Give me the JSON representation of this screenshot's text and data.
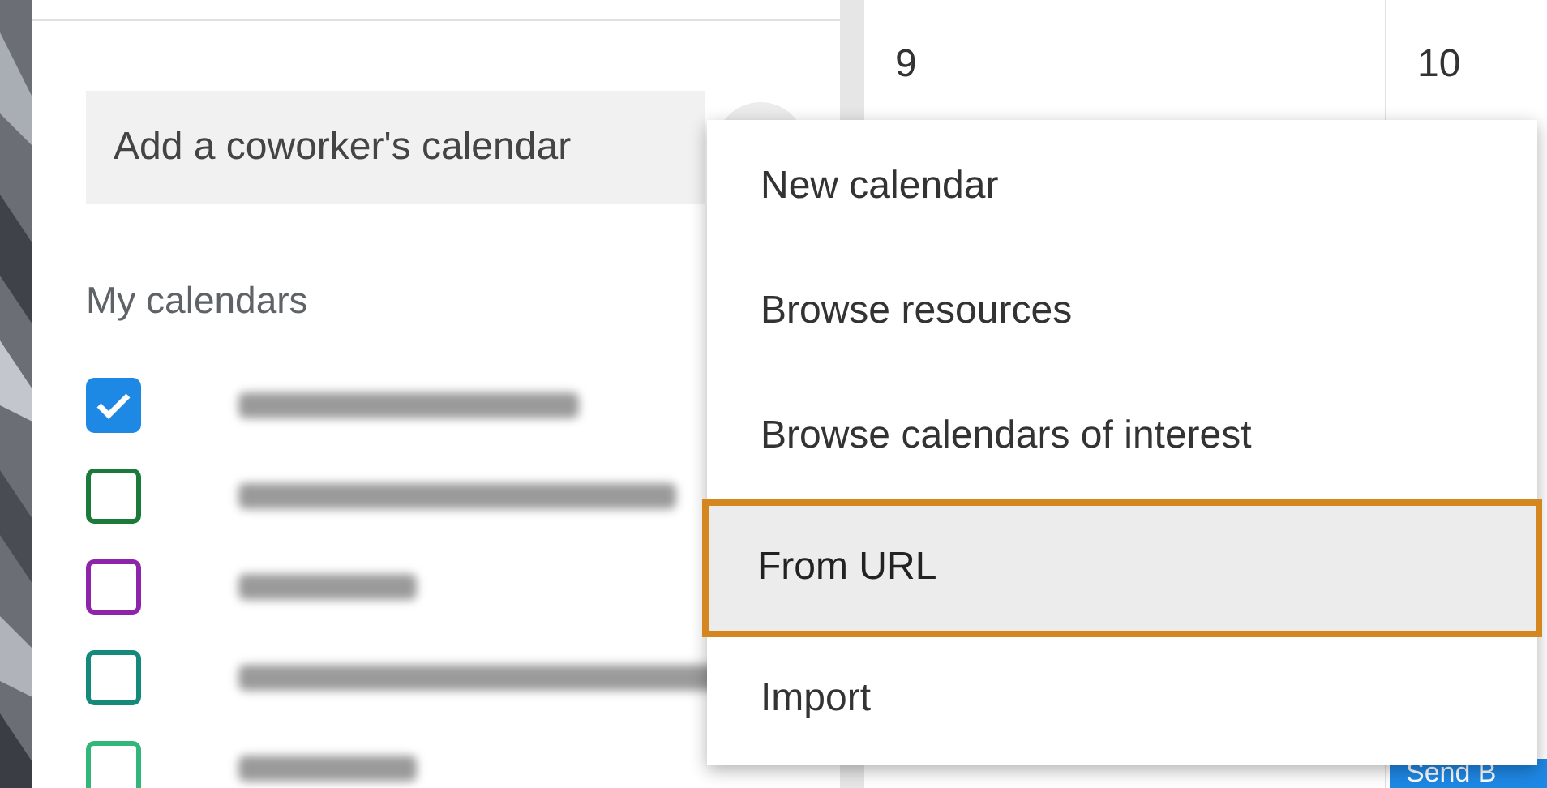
{
  "search": {
    "placeholder": "Add a coworker's calendar"
  },
  "section_title": "My calendars",
  "calendars": [
    {
      "checked": true,
      "color": "#1e88e5"
    },
    {
      "checked": false,
      "color": "#1b7a3a"
    },
    {
      "checked": false,
      "color": "#8e24aa"
    },
    {
      "checked": false,
      "color": "#15897a"
    },
    {
      "checked": false,
      "color": "#33b679"
    }
  ],
  "days": [
    "9",
    "10"
  ],
  "event": {
    "label": "Send B"
  },
  "menu": {
    "items": [
      {
        "label": "New calendar",
        "selected": false
      },
      {
        "label": "Browse resources",
        "selected": false
      },
      {
        "label": "Browse calendars of interest",
        "selected": false
      },
      {
        "label": "From URL",
        "selected": true
      },
      {
        "label": "Import",
        "selected": false
      }
    ]
  }
}
